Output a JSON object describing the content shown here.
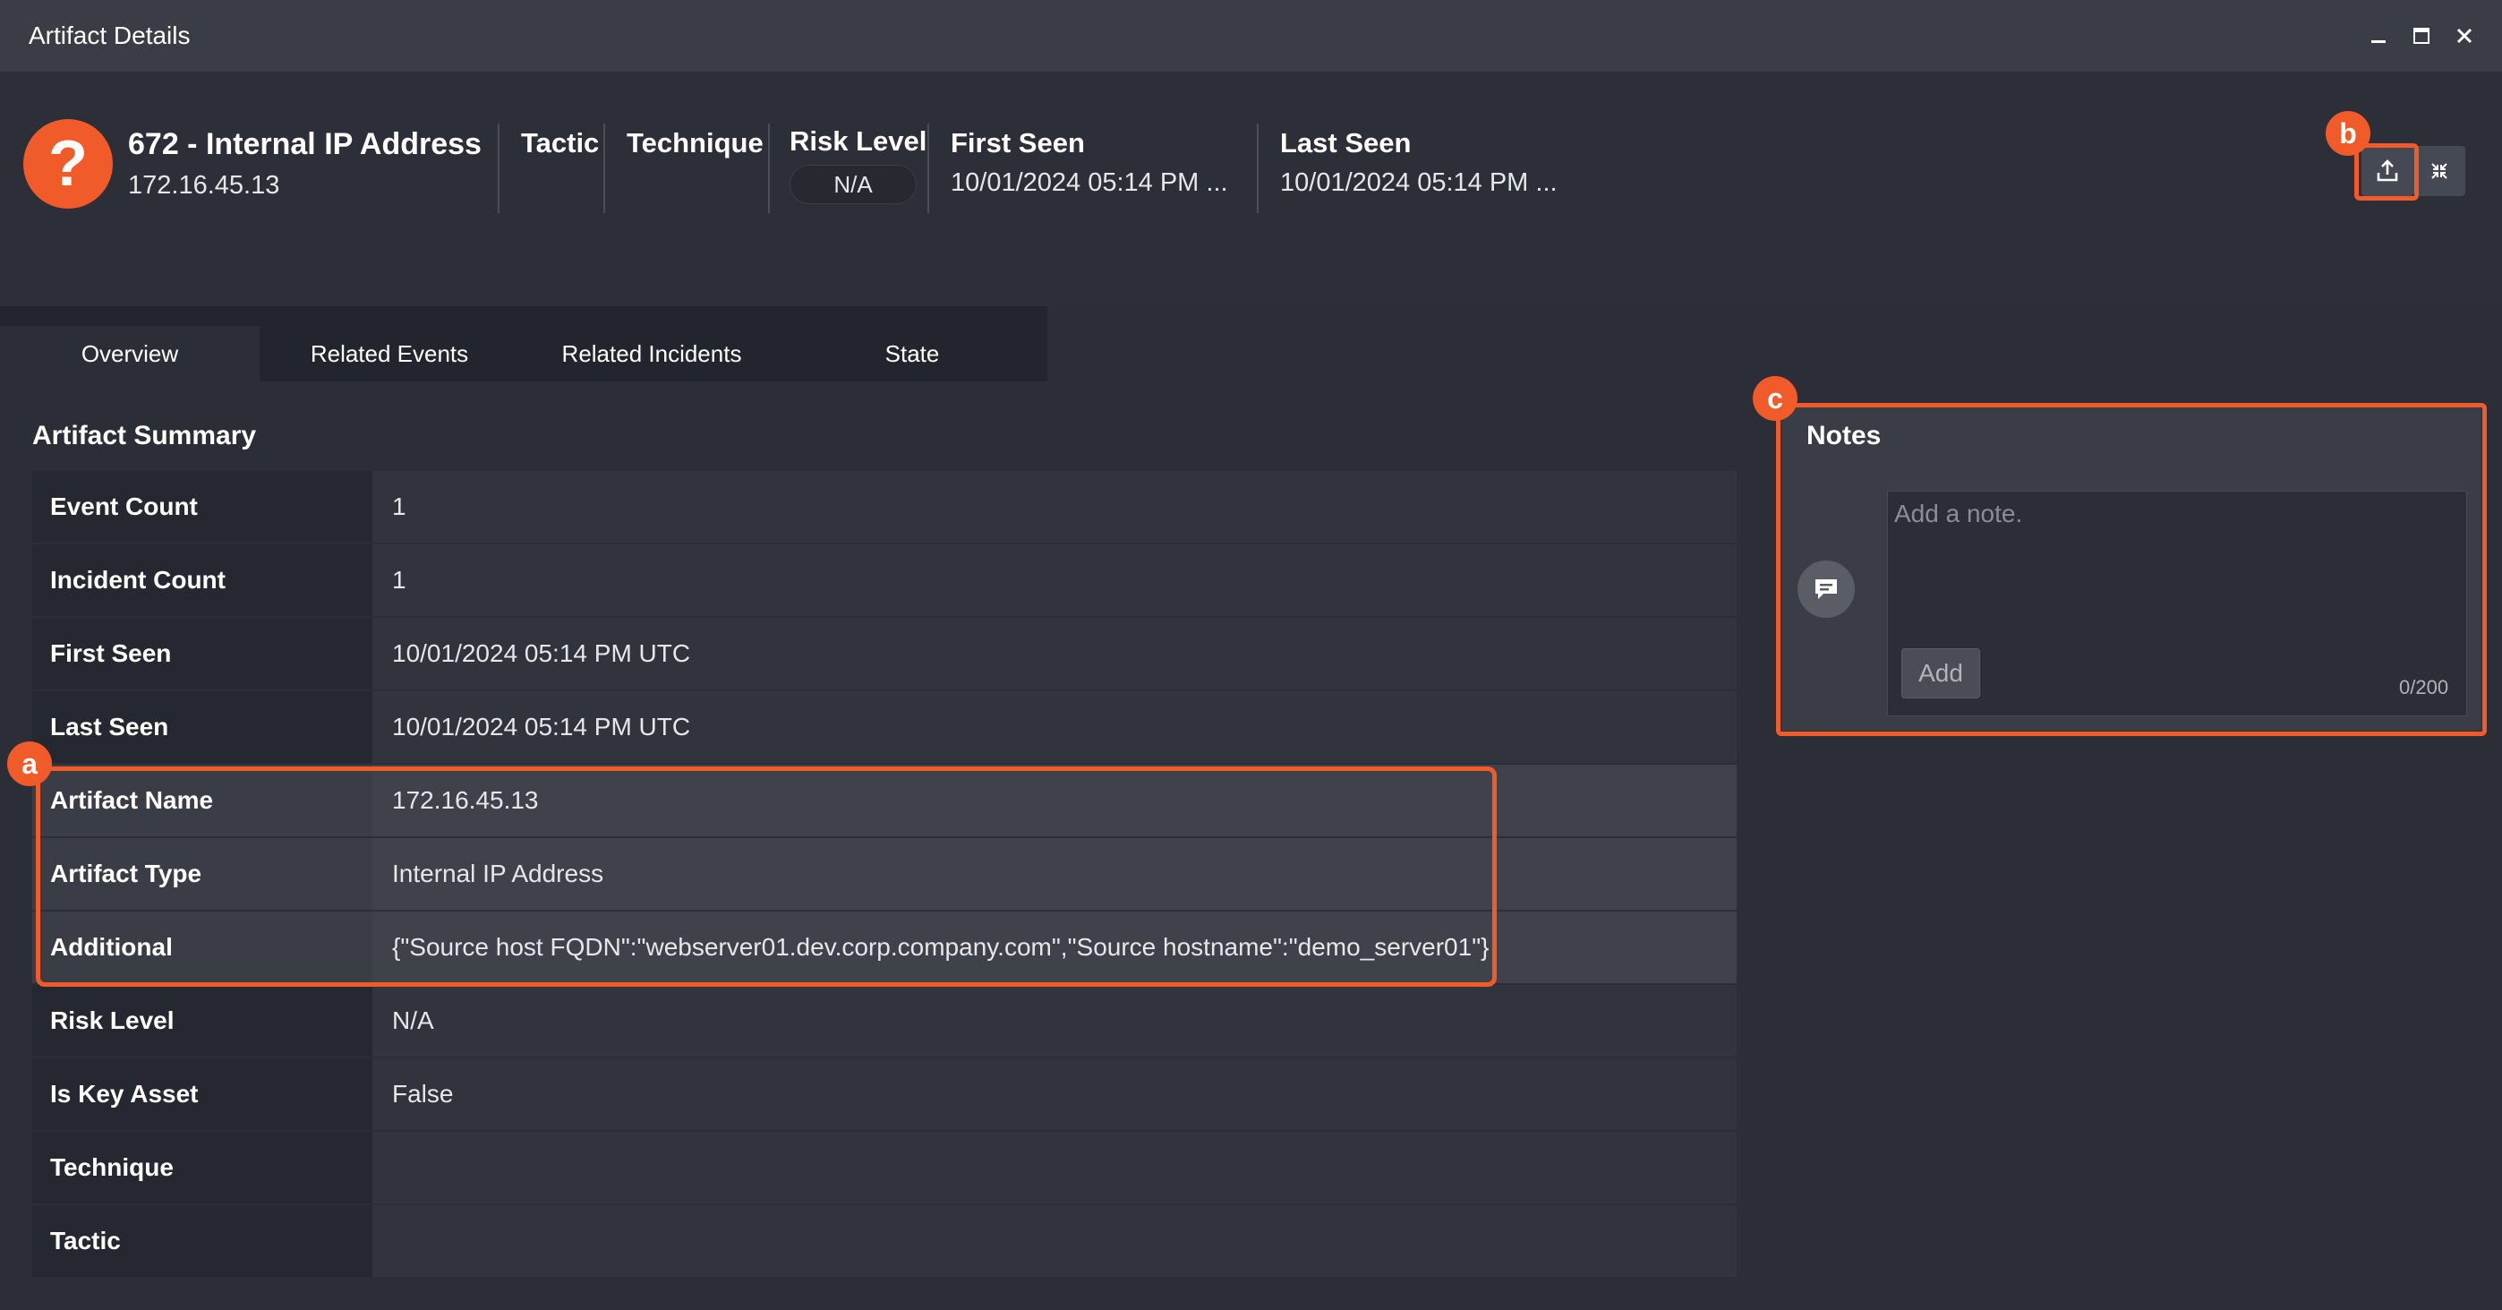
{
  "window": {
    "title": "Artifact Details"
  },
  "header": {
    "icon_glyph": "?",
    "title": "672 - Internal IP Address",
    "subtitle": "172.16.45.13",
    "tactic_label": "Tactic",
    "technique_label": "Technique",
    "risk_label": "Risk Level",
    "risk_value": "N/A",
    "first_seen_label": "First Seen",
    "first_seen_value": "10/01/2024 05:14 PM ...",
    "last_seen_label": "Last Seen",
    "last_seen_value": "10/01/2024 05:14 PM ..."
  },
  "tabs": [
    {
      "label": "Overview",
      "active": true
    },
    {
      "label": "Related Events",
      "active": false
    },
    {
      "label": "Related Incidents",
      "active": false
    },
    {
      "label": "State",
      "active": false
    }
  ],
  "summary": {
    "title": "Artifact Summary",
    "rows": [
      {
        "key": "Event Count",
        "value": "1"
      },
      {
        "key": "Incident Count",
        "value": "1"
      },
      {
        "key": "First Seen",
        "value": "10/01/2024 05:14 PM UTC"
      },
      {
        "key": "Last Seen",
        "value": "10/01/2024 05:14 PM UTC"
      },
      {
        "key": "Artifact Name",
        "value": "172.16.45.13"
      },
      {
        "key": "Artifact Type",
        "value": "Internal IP Address"
      },
      {
        "key": "Additional",
        "value": "{\"Source host FQDN\":\"webserver01.dev.corp.company.com\",\"Source hostname\":\"demo_server01\"}"
      },
      {
        "key": "Risk Level",
        "value": "N/A"
      },
      {
        "key": "Is Key Asset",
        "value": "False"
      },
      {
        "key": "Technique",
        "value": ""
      },
      {
        "key": "Tactic",
        "value": ""
      }
    ]
  },
  "notes": {
    "title": "Notes",
    "placeholder": "Add a note.",
    "add_label": "Add",
    "char_count": "0/200"
  },
  "callouts": {
    "a": "a",
    "b": "b",
    "c": "c"
  },
  "colors": {
    "accent": "#f15a29",
    "background": "#2b2e37",
    "titlebar": "#3a3d46",
    "panel": "#3a3d46"
  },
  "icons": {
    "minimize": "minimize-icon",
    "maximize": "maximize-icon",
    "close": "close-icon",
    "export": "export-upload-icon",
    "collapse": "collapse-icon",
    "note": "chat-bubble-icon"
  }
}
